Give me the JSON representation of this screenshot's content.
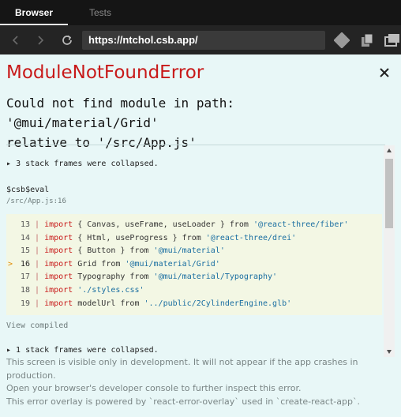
{
  "tabs": [
    {
      "label": "Browser",
      "active": true
    },
    {
      "label": "Tests",
      "active": false
    }
  ],
  "toolbar": {
    "url": "https://ntchol.csb.app/",
    "icons": [
      "back-arrow-icon",
      "forward-arrow-icon",
      "refresh-icon",
      "puzzle-icon",
      "copy-icon",
      "windows-icon"
    ]
  },
  "error": {
    "title": "ModuleNotFoundError",
    "message_line1": "Could not find module in path: '@mui/material/Grid'",
    "message_line2": "relative to '/src/App.js'",
    "collapsed_frames": "3 stack frames were collapsed.",
    "function_name": "$csb$eval",
    "function_location": "/src/App.js:16",
    "view_compiled": "View compiled",
    "more_frames": "▸ 1 stack frames were collapsed."
  },
  "code_lines": [
    {
      "num": "13",
      "kw": "import",
      "pre": " { Canvas, useFrame, useLoader } from ",
      "str": "'@react-three/fiber'",
      "highlight": false
    },
    {
      "num": "14",
      "kw": "import",
      "pre": " { Html, useProgress } from ",
      "str": "'@react-three/drei'",
      "highlight": false
    },
    {
      "num": "15",
      "kw": "import",
      "pre": " { Button } from ",
      "str": "'@mui/material'",
      "highlight": false
    },
    {
      "num": "16",
      "kw": "import",
      "pre": " Grid from ",
      "str": "'@mui/material/Grid'",
      "highlight": true
    },
    {
      "num": "17",
      "kw": "import",
      "pre": " Typography from ",
      "str": "'@mui/material/Typography'",
      "highlight": false
    },
    {
      "num": "18",
      "kw": "import",
      "pre": " ",
      "str": "'./styles.css'",
      "highlight": false
    },
    {
      "num": "19",
      "kw": "import",
      "pre": " modelUrl from ",
      "str": "'../public/2CylinderEngine.glb'",
      "highlight": false
    }
  ],
  "footer": {
    "line1": "This screen is visible only in development. It will not appear if the app crashes in production.",
    "line2": "Open your browser's developer console to further inspect this error.",
    "line3": "This error overlay is powered by `react-error-overlay` used in `create-react-app`."
  },
  "colors": {
    "error_red": "#c81919",
    "overlay_bg": "#e8f7f7",
    "code_bg": "#f3f7e4",
    "string_blue": "#1a6ea1"
  }
}
